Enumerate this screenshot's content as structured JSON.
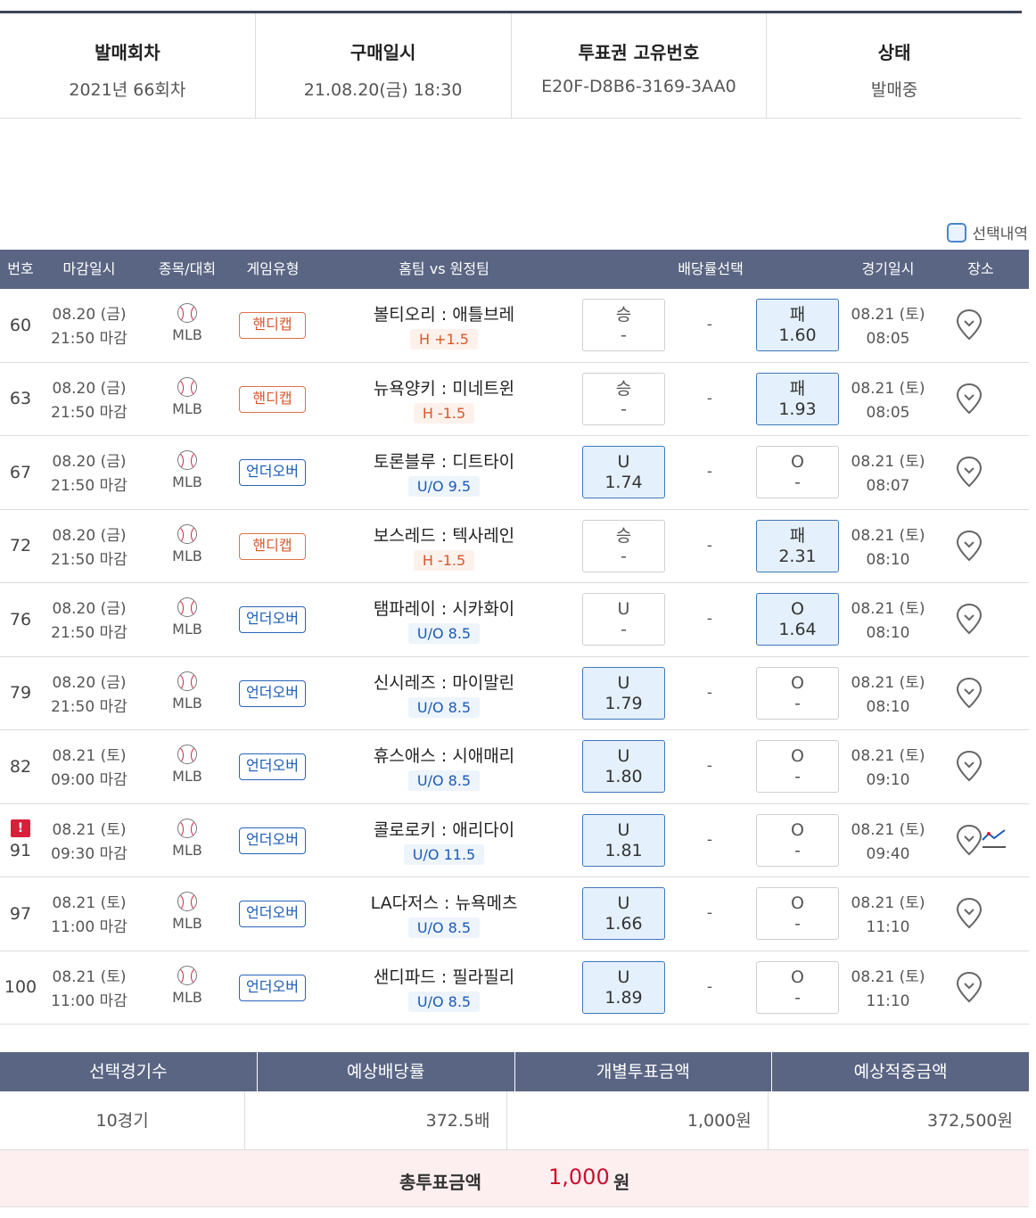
{
  "info": [
    {
      "label": "발매회차",
      "value": "2021년 66회차"
    },
    {
      "label": "구매일시",
      "value": "21.08.20(금) 18:30"
    },
    {
      "label": "투표권 고유번호",
      "value": "E20F-D8B6-3169-3AA0"
    },
    {
      "label": "상태",
      "value": "발매중"
    }
  ],
  "legend": {
    "label": "선택내역"
  },
  "table": {
    "headers": [
      "번호",
      "마감일시",
      "종목/대회",
      "게임유형",
      "홈팀 vs 원정팀",
      "배당률선택",
      "경기일시",
      "장소"
    ],
    "rows": [
      {
        "num": "60",
        "alert": "",
        "deadline_date": "08.20 (금)",
        "deadline_time": "21:50 마감",
        "league": "MLB",
        "type": "핸디캡",
        "type_kind": "hc",
        "teams": "볼티오리 : 애틀브레",
        "line": "H +1.5",
        "line_kind": "h",
        "left_label": "승",
        "left_odd": "-",
        "left_sel": false,
        "draw": "-",
        "right_label": "패",
        "right_odd": "1.60",
        "right_sel": true,
        "game_date": "08.21 (토)",
        "game_time": "08:05",
        "chart": false
      },
      {
        "num": "63",
        "alert": "",
        "deadline_date": "08.20 (금)",
        "deadline_time": "21:50 마감",
        "league": "MLB",
        "type": "핸디캡",
        "type_kind": "hc",
        "teams": "뉴욕양키 : 미네트윈",
        "line": "H -1.5",
        "line_kind": "h",
        "left_label": "승",
        "left_odd": "-",
        "left_sel": false,
        "draw": "-",
        "right_label": "패",
        "right_odd": "1.93",
        "right_sel": true,
        "game_date": "08.21 (토)",
        "game_time": "08:05",
        "chart": false
      },
      {
        "num": "67",
        "alert": "",
        "deadline_date": "08.20 (금)",
        "deadline_time": "21:50 마감",
        "league": "MLB",
        "type": "언더오버",
        "type_kind": "uo",
        "teams": "토론블루 : 디트타이",
        "line": "U/O 9.5",
        "line_kind": "u",
        "left_label": "U",
        "left_odd": "1.74",
        "left_sel": true,
        "draw": "-",
        "right_label": "O",
        "right_odd": "-",
        "right_sel": false,
        "game_date": "08.21 (토)",
        "game_time": "08:07",
        "chart": false
      },
      {
        "num": "72",
        "alert": "",
        "deadline_date": "08.20 (금)",
        "deadline_time": "21:50 마감",
        "league": "MLB",
        "type": "핸디캡",
        "type_kind": "hc",
        "teams": "보스레드 : 텍사레인",
        "line": "H -1.5",
        "line_kind": "h",
        "left_label": "승",
        "left_odd": "-",
        "left_sel": false,
        "draw": "-",
        "right_label": "패",
        "right_odd": "2.31",
        "right_sel": true,
        "game_date": "08.21 (토)",
        "game_time": "08:10",
        "chart": false
      },
      {
        "num": "76",
        "alert": "",
        "deadline_date": "08.20 (금)",
        "deadline_time": "21:50 마감",
        "league": "MLB",
        "type": "언더오버",
        "type_kind": "uo",
        "teams": "탬파레이 : 시카화이",
        "line": "U/O 8.5",
        "line_kind": "u",
        "left_label": "U",
        "left_odd": "-",
        "left_sel": false,
        "draw": "-",
        "right_label": "O",
        "right_odd": "1.64",
        "right_sel": true,
        "game_date": "08.21 (토)",
        "game_time": "08:10",
        "chart": false
      },
      {
        "num": "79",
        "alert": "",
        "deadline_date": "08.20 (금)",
        "deadline_time": "21:50 마감",
        "league": "MLB",
        "type": "언더오버",
        "type_kind": "uo",
        "teams": "신시레즈 : 마이말린",
        "line": "U/O 8.5",
        "line_kind": "u",
        "left_label": "U",
        "left_odd": "1.79",
        "left_sel": true,
        "draw": "-",
        "right_label": "O",
        "right_odd": "-",
        "right_sel": false,
        "game_date": "08.21 (토)",
        "game_time": "08:10",
        "chart": false
      },
      {
        "num": "82",
        "alert": "",
        "deadline_date": "08.21 (토)",
        "deadline_time": "09:00 마감",
        "league": "MLB",
        "type": "언더오버",
        "type_kind": "uo",
        "teams": "휴스애스 : 시애매리",
        "line": "U/O 8.5",
        "line_kind": "u",
        "left_label": "U",
        "left_odd": "1.80",
        "left_sel": true,
        "draw": "-",
        "right_label": "O",
        "right_odd": "-",
        "right_sel": false,
        "game_date": "08.21 (토)",
        "game_time": "09:10",
        "chart": false
      },
      {
        "num": "91",
        "alert": "!",
        "deadline_date": "08.21 (토)",
        "deadline_time": "09:30 마감",
        "league": "MLB",
        "type": "언더오버",
        "type_kind": "uo",
        "teams": "콜로로키 : 애리다이",
        "line": "U/O 11.5",
        "line_kind": "u",
        "left_label": "U",
        "left_odd": "1.81",
        "left_sel": true,
        "draw": "-",
        "right_label": "O",
        "right_odd": "-",
        "right_sel": false,
        "game_date": "08.21 (토)",
        "game_time": "09:40",
        "chart": true
      },
      {
        "num": "97",
        "alert": "",
        "deadline_date": "08.21 (토)",
        "deadline_time": "11:00 마감",
        "league": "MLB",
        "type": "언더오버",
        "type_kind": "uo",
        "teams": "LA다저스 : 뉴욕메츠",
        "line": "U/O 8.5",
        "line_kind": "u",
        "left_label": "U",
        "left_odd": "1.66",
        "left_sel": true,
        "draw": "-",
        "right_label": "O",
        "right_odd": "-",
        "right_sel": false,
        "game_date": "08.21 (토)",
        "game_time": "11:10",
        "chart": false
      },
      {
        "num": "100",
        "alert": "",
        "deadline_date": "08.21 (토)",
        "deadline_time": "11:00 마감",
        "league": "MLB",
        "type": "언더오버",
        "type_kind": "uo",
        "teams": "샌디파드 : 필라필리",
        "line": "U/O 8.5",
        "line_kind": "u",
        "left_label": "U",
        "left_odd": "1.89",
        "left_sel": true,
        "draw": "-",
        "right_label": "O",
        "right_odd": "-",
        "right_sel": false,
        "game_date": "08.21 (토)",
        "game_time": "11:10",
        "chart": false
      }
    ]
  },
  "summary": {
    "headers": [
      "선택경기수",
      "예상배당률",
      "개별투표금액",
      "예상적중금액"
    ],
    "values": [
      "10경기",
      "372.5배",
      "1,000원",
      "372,500원"
    ],
    "total_label": "총투표금액",
    "total_amount": "1,000",
    "total_unit": "원"
  },
  "colors": {
    "header_bg": "#5a6583",
    "selected_bg": "#e4f0fb",
    "selected_border": "#3f78b8",
    "handicap": "#d9572b",
    "underover": "#1a5bb5",
    "total_amount": "#c8102e",
    "alert": "#d8203b"
  },
  "icons": {
    "sport": "baseball-icon",
    "place": "map-pin-icon",
    "chart": "chart-icon",
    "alert": "alert-icon"
  }
}
